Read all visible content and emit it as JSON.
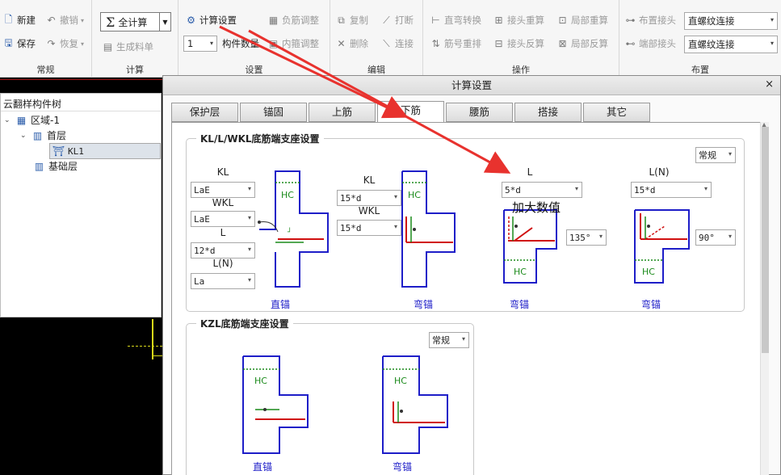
{
  "ribbon": {
    "groups": {
      "general": "常规",
      "calc": "计算",
      "settings": "设置",
      "edit": "编辑",
      "ops": "操作",
      "layout": "布置"
    },
    "buttons": {
      "new": "新建",
      "save": "保存",
      "undo": "撤销",
      "redo": "恢复",
      "calc_all": "全计算",
      "gen_list": "生成料单",
      "calc_settings": "计算设置",
      "member_count": "构件数量",
      "member_count_value": "1",
      "neg_adjust": "负筋调整",
      "stirrup_adjust": "内箍调整",
      "copy": "复制",
      "delete": "删除",
      "break": "打断",
      "connect": "连接",
      "straight_bend": "直弯转换",
      "rebar_reorder": "筋号重排",
      "joint_recalc": "接头重算",
      "joint_reverse": "接头反算",
      "local_recalc": "局部重算",
      "local_reverse": "局部反算",
      "place_joint": "布置接头",
      "end_joint": "端部接头",
      "joint_type_1": "直螺纹连接",
      "joint_type_2": "直螺纹连接"
    }
  },
  "tree": {
    "title": "云翻样构件树",
    "items": [
      "区域-1",
      "首层",
      "KL1",
      "基础层"
    ]
  },
  "dialog": {
    "title": "计算设置",
    "close": "×",
    "tabs": [
      "保护层",
      "锚固",
      "上筋",
      "下筋",
      "腰筋",
      "搭接",
      "其它"
    ],
    "active_tab": "下筋",
    "section1": {
      "title": "KL/L/WKL底筋端支座设置",
      "mode": "常规",
      "group1": {
        "labels": [
          "KL",
          "WKL",
          "L",
          "L(N)"
        ],
        "values": [
          "LaE",
          "LaE",
          "12*d",
          "La"
        ],
        "caption": "直锚"
      },
      "group2": {
        "labels": [
          "KL",
          "WKL"
        ],
        "values": [
          "15*d",
          "15*d"
        ],
        "caption": "弯锚"
      },
      "group3": {
        "label": "L",
        "value": "5*d",
        "angle": "135°",
        "caption": "弯锚"
      },
      "group4": {
        "label": "L(N)",
        "value": "15*d",
        "angle": "90°",
        "caption": "弯锚"
      },
      "hc": "HC"
    },
    "section2": {
      "title": "KZL底筋端支座设置",
      "mode": "常规",
      "captions": [
        "直锚",
        "弯锚"
      ],
      "hc": "HC"
    }
  },
  "annotation": "加大数值",
  "colors": {
    "accent_red": "#e8322e",
    "rebar_blue": "#1e1ec8",
    "rebar_red": "#d01010",
    "hc_green": "#1a8a1a"
  },
  "icons": [
    "new-icon",
    "save-icon",
    "undo-icon",
    "redo-icon",
    "sigma-icon",
    "calc-settings-icon",
    "copy-icon",
    "delete-icon",
    "break-icon",
    "connect-icon",
    "close-icon",
    "chevron-down-icon",
    "expand-icon",
    "floor-icon",
    "beam-icon"
  ]
}
